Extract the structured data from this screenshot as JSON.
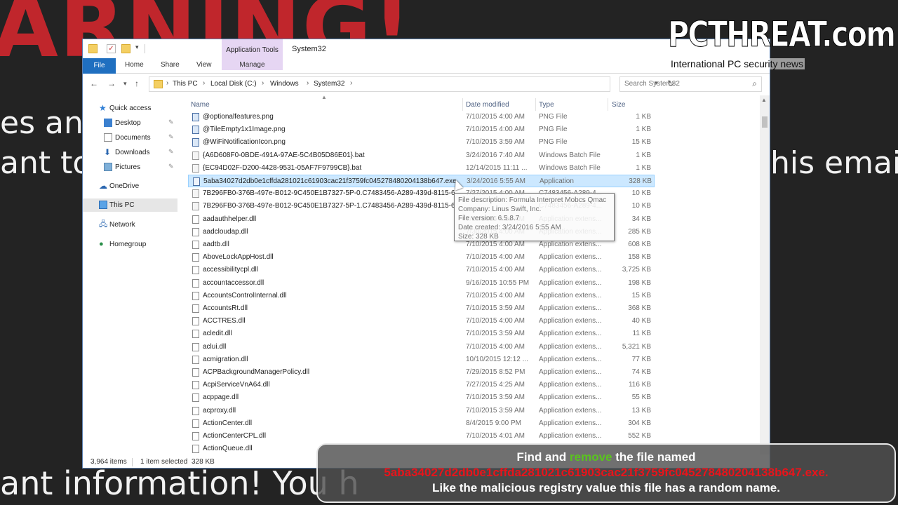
{
  "background": {
    "warning": "ARNING!",
    "line2": "es and",
    "line3": "ant to",
    "line4": "his email:",
    "line5": "ant information! You h"
  },
  "logo": {
    "main": "PCTHREAT.com",
    "tagline": "International PC security news"
  },
  "window": {
    "title": "System32",
    "ribbon": {
      "context_group": "Application Tools",
      "tabs": [
        "File",
        "Home",
        "Share",
        "View",
        "Manage"
      ]
    },
    "address": {
      "crumbs": [
        "This PC",
        "Local Disk (C:)",
        "Windows",
        "System32"
      ],
      "search_placeholder": "Search System32"
    },
    "nav": {
      "quick_access": "Quick access",
      "items": [
        "Desktop",
        "Documents",
        "Downloads",
        "Pictures"
      ],
      "onedrive": "OneDrive",
      "this_pc": "This PC",
      "network": "Network",
      "homegroup": "Homegroup"
    },
    "columns": {
      "name": "Name",
      "date": "Date modified",
      "type": "Type",
      "size": "Size"
    },
    "files": [
      {
        "name": "@optionalfeatures.png",
        "date": "7/10/2015 4:00 AM",
        "type": "PNG File",
        "size": "1 KB",
        "icon": "image"
      },
      {
        "name": "@TileEmpty1x1Image.png",
        "date": "7/10/2015 4:00 AM",
        "type": "PNG File",
        "size": "1 KB",
        "icon": "image"
      },
      {
        "name": "@WiFiNotificationIcon.png",
        "date": "7/10/2015 3:59 AM",
        "type": "PNG File",
        "size": "15 KB",
        "icon": "image"
      },
      {
        "name": "{A6D608F0-0BDE-491A-97AE-5C4B05D86E01}.bat",
        "date": "3/24/2016 7:40 AM",
        "type": "Windows Batch File",
        "size": "1 KB",
        "icon": "batch"
      },
      {
        "name": "{EC94D02F-D200-4428-9531-05AF7F9799CB}.bat",
        "date": "12/14/2015 11:11 ...",
        "type": "Windows Batch File",
        "size": "1 KB",
        "icon": "batch"
      },
      {
        "name": "5aba34027d2db0e1cffda281021c61903cac21f3759fc045278480204138b647.exe",
        "date": "3/24/2016 5:55 AM",
        "type": "Application",
        "size": "328 KB",
        "icon": "exe",
        "selected": true
      },
      {
        "name": "7B296FB0-376B-497e-B012-9C450E1B7327-5P-0.C7483456-A289-439d-8115-60...",
        "date": "7/27/2015 4:00 AM",
        "type": "C7483456-A289-4...",
        "size": "10 KB",
        "icon": "blank"
      },
      {
        "name": "7B296FB0-376B-497e-B012-9C450E1B7327-5P-1.C7483456-A289-439d-8115-60...",
        "date": "",
        "type": "C7483456-A289-4...",
        "size": "10 KB",
        "icon": "blank"
      },
      {
        "name": "aadauthhelper.dll",
        "date": "7/10/2015 4:00 AM",
        "type": "Application extens...",
        "size": "34 KB",
        "icon": "dll"
      },
      {
        "name": "aadcloudap.dll",
        "date": "7/30/2015 4:00 AM",
        "type": "Application extens...",
        "size": "285 KB",
        "icon": "dll"
      },
      {
        "name": "aadtb.dll",
        "date": "7/10/2015 4:00 AM",
        "type": "Application extens...",
        "size": "608 KB",
        "icon": "dll"
      },
      {
        "name": "AboveLockAppHost.dll",
        "date": "7/10/2015 4:00 AM",
        "type": "Application extens...",
        "size": "158 KB",
        "icon": "dll"
      },
      {
        "name": "accessibilitycpl.dll",
        "date": "7/10/2015 4:00 AM",
        "type": "Application extens...",
        "size": "3,725 KB",
        "icon": "dll"
      },
      {
        "name": "accountaccessor.dll",
        "date": "9/16/2015 10:55 PM",
        "type": "Application extens...",
        "size": "198 KB",
        "icon": "dll"
      },
      {
        "name": "AccountsControlInternal.dll",
        "date": "7/10/2015 4:00 AM",
        "type": "Application extens...",
        "size": "15 KB",
        "icon": "dll"
      },
      {
        "name": "AccountsRt.dll",
        "date": "7/10/2015 3:59 AM",
        "type": "Application extens...",
        "size": "368 KB",
        "icon": "dll"
      },
      {
        "name": "ACCTRES.dll",
        "date": "7/10/2015 4:00 AM",
        "type": "Application extens...",
        "size": "40 KB",
        "icon": "dll"
      },
      {
        "name": "acledit.dll",
        "date": "7/10/2015 3:59 AM",
        "type": "Application extens...",
        "size": "11 KB",
        "icon": "dll"
      },
      {
        "name": "aclui.dll",
        "date": "7/10/2015 4:00 AM",
        "type": "Application extens...",
        "size": "5,321 KB",
        "icon": "dll"
      },
      {
        "name": "acmigration.dll",
        "date": "10/10/2015 12:12 ...",
        "type": "Application extens...",
        "size": "77 KB",
        "icon": "dll"
      },
      {
        "name": "ACPBackgroundManagerPolicy.dll",
        "date": "7/29/2015 8:52 PM",
        "type": "Application extens...",
        "size": "74 KB",
        "icon": "dll"
      },
      {
        "name": "AcpiServiceVnA64.dll",
        "date": "7/27/2015 4:25 AM",
        "type": "Application extens...",
        "size": "116 KB",
        "icon": "dll"
      },
      {
        "name": "acppage.dll",
        "date": "7/10/2015 3:59 AM",
        "type": "Application extens...",
        "size": "55 KB",
        "icon": "dll"
      },
      {
        "name": "acproxy.dll",
        "date": "7/10/2015 3:59 AM",
        "type": "Application extens...",
        "size": "13 KB",
        "icon": "dll"
      },
      {
        "name": "ActionCenter.dll",
        "date": "8/4/2015 9:00 PM",
        "type": "Application extens...",
        "size": "304 KB",
        "icon": "dll"
      },
      {
        "name": "ActionCenterCPL.dll",
        "date": "7/10/2015 4:01 AM",
        "type": "Application extens...",
        "size": "552 KB",
        "icon": "dll"
      },
      {
        "name": "ActionQueue.dll",
        "date": "",
        "type": "",
        "size": "",
        "icon": "dll"
      }
    ],
    "tooltip": [
      "File description: Formula Interpret Mobcs Qmac",
      "Company: Linus Swift, Inc.",
      "File version: 6.5.8.7",
      "Date created: 3/24/2016 5:55 AM",
      "Size: 328 KB"
    ],
    "status": {
      "items": "3,964 items",
      "selected": "1 item selected",
      "size": "328 KB"
    }
  },
  "caption": {
    "l1_a": "Find and",
    "l1_b": "remove",
    "l1_c": "the file named",
    "l2": "5aba34027d2db0e1cffda281021c61903cac21f3759fc045278480204138b647.exe.",
    "l3": "Like the malicious registry value this file has a random name."
  },
  "colors": {
    "accent": "#1f6fc0",
    "selection": "#cce8ff",
    "caption_red": "#e8141b",
    "caption_green": "#5ac31e"
  }
}
